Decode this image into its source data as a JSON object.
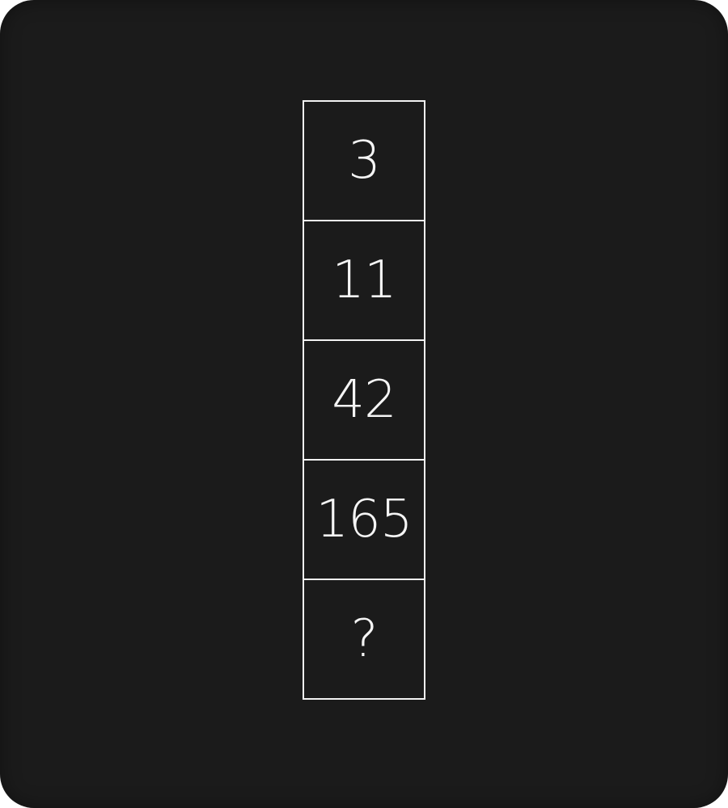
{
  "puzzle": {
    "cells": [
      {
        "value": "3"
      },
      {
        "value": "11"
      },
      {
        "value": "42"
      },
      {
        "value": "165"
      },
      {
        "value": "?"
      }
    ]
  }
}
